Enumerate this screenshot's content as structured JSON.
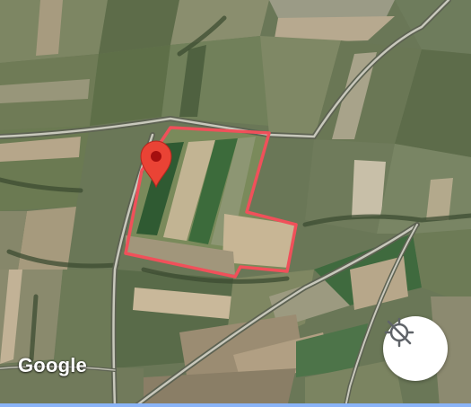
{
  "map": {
    "type": "satellite",
    "attribution": "Google",
    "boundary_color": "#f0505a",
    "marker_color": "#ea4335"
  },
  "controls": {
    "location_button_icon": "gps-off-icon"
  }
}
